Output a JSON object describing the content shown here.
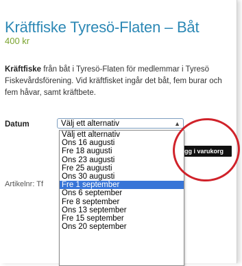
{
  "product": {
    "title": "Kräftfiske Tyresö-Flaten – Båt",
    "price": "400 kr",
    "description_bold": "Kräftfiske",
    "description_rest": " från båt i Tyresö-Flaten för medlemmar i Tyresö Fiskevårdsförening. Vid kräftfisket ingår det båt, fem burar och fem håvar, samt kräftbete.",
    "article_label": "Artikelnr: Tf"
  },
  "form": {
    "datum_label": "Datum",
    "select_value": "Välj ett alternativ",
    "options": [
      "Välj ett alternativ",
      "Ons 16 augusti",
      "Fre 18 augusti",
      "Ons 23 augusti",
      "Fre 25 augusti",
      "Ons 30 augusti",
      "Fre 1 september",
      "Ons 6 september",
      "Fre 8 september",
      "Ons 13 september",
      "Fre 15 september",
      "Ons 20 september"
    ],
    "highlighted_option": "Fre 1 september",
    "cart_button": "ägg i varukorg"
  },
  "colors": {
    "title": "#2c88b5",
    "price": "#7aa32e",
    "highlight": "#3875d7",
    "annotation_circle": "#d0222a"
  }
}
